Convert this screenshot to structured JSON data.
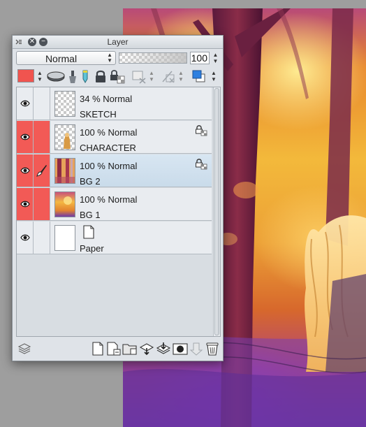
{
  "panel": {
    "title": "Layer",
    "blend_mode": "Normal",
    "opacity_value": "100",
    "current_color": "#f0544f"
  },
  "layers": [
    {
      "opacity_mode": "34 % Normal",
      "name": "SKETCH",
      "highlight": false,
      "selected": false
    },
    {
      "opacity_mode": "100 % Normal",
      "name": "CHARACTER",
      "highlight": true,
      "selected": false
    },
    {
      "opacity_mode": "100 % Normal",
      "name": "BG 2",
      "highlight": true,
      "selected": true
    },
    {
      "opacity_mode": "100 % Normal",
      "name": "BG 1",
      "highlight": true,
      "selected": false
    },
    {
      "opacity_mode": "",
      "name": "Paper",
      "highlight": false,
      "selected": false
    }
  ],
  "colors": {
    "highlight_red": "#f25a56",
    "selected_row": "#c9dbea",
    "panel_bg": "#dfe3e8"
  },
  "icons": {
    "visibility": "eye-icon",
    "editing": "brush-icon",
    "layer_lock": "lock-icon",
    "paper_layer": "paper-icon"
  }
}
